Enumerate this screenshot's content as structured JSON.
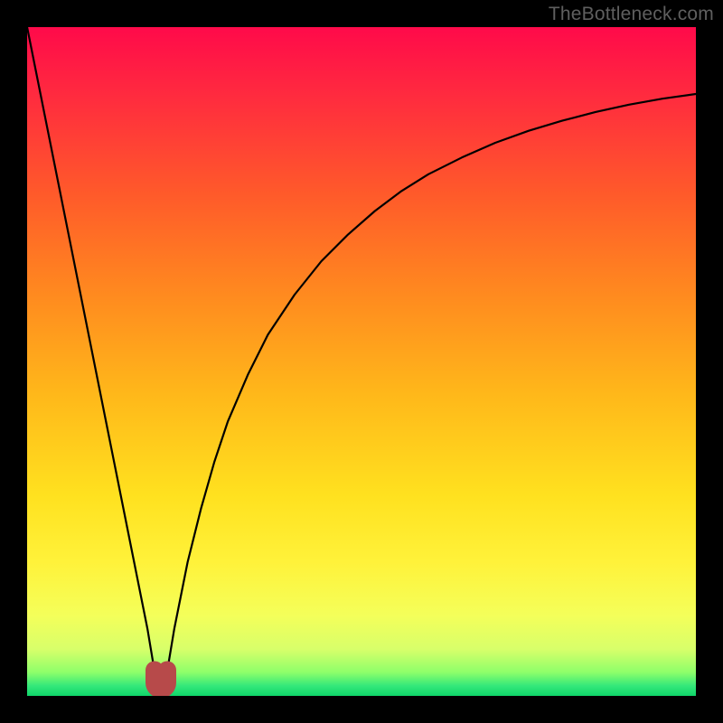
{
  "watermark": "TheBottleneck.com",
  "chart_data": {
    "type": "line",
    "title": "",
    "xlabel": "",
    "ylabel": "",
    "xlim": [
      0,
      100
    ],
    "ylim": [
      0,
      100
    ],
    "curve_minimum_x": 20,
    "x": [
      0,
      2,
      4,
      6,
      8,
      10,
      12,
      14,
      15,
      16,
      17,
      18,
      18.5,
      19,
      19.5,
      20,
      20.5,
      21,
      21.5,
      22,
      23,
      24,
      26,
      28,
      30,
      33,
      36,
      40,
      44,
      48,
      52,
      56,
      60,
      65,
      70,
      75,
      80,
      85,
      90,
      95,
      100
    ],
    "y": [
      100,
      90,
      80,
      70,
      60,
      50,
      40,
      30,
      25,
      20,
      15,
      10,
      7,
      4,
      2,
      1,
      2,
      4,
      7,
      10,
      15,
      20,
      28,
      35,
      41,
      48,
      54,
      60,
      65,
      69,
      72.5,
      75.5,
      78,
      80.5,
      82.7,
      84.5,
      86,
      87.3,
      88.4,
      89.3,
      90
    ],
    "marker": {
      "shape": "u",
      "cx": 20,
      "cy": 2.5,
      "color": "#b74a4a"
    },
    "gradient_stops": [
      {
        "offset": 0.0,
        "color": "#ff0a4a"
      },
      {
        "offset": 0.1,
        "color": "#ff2a3f"
      },
      {
        "offset": 0.25,
        "color": "#ff5a2a"
      },
      {
        "offset": 0.4,
        "color": "#ff8a1f"
      },
      {
        "offset": 0.55,
        "color": "#ffb81a"
      },
      {
        "offset": 0.7,
        "color": "#ffe11f"
      },
      {
        "offset": 0.8,
        "color": "#fff23a"
      },
      {
        "offset": 0.88,
        "color": "#f4ff5a"
      },
      {
        "offset": 0.93,
        "color": "#d8ff6a"
      },
      {
        "offset": 0.965,
        "color": "#8dff6a"
      },
      {
        "offset": 0.985,
        "color": "#34e87a"
      },
      {
        "offset": 1.0,
        "color": "#0fd66a"
      }
    ]
  }
}
